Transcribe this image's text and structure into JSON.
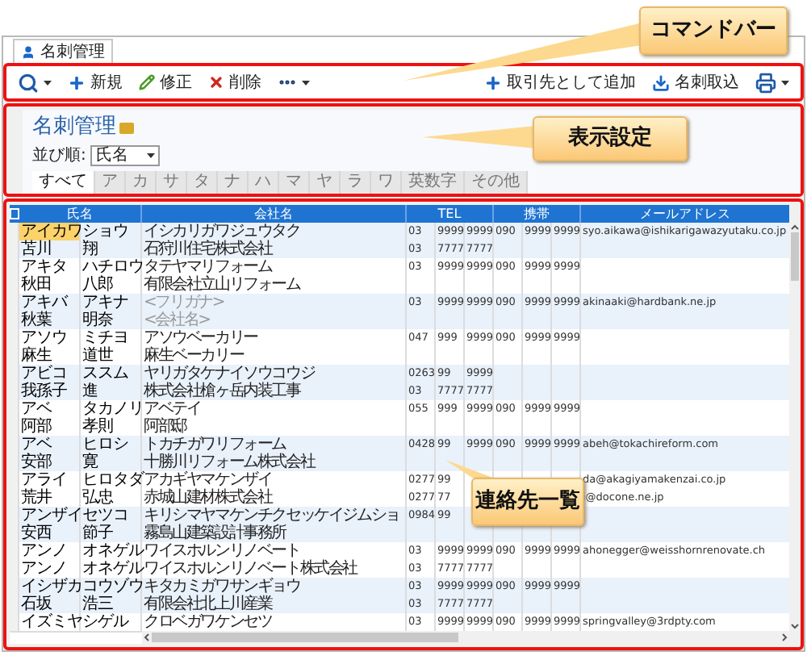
{
  "tab": {
    "label": "名刺管理"
  },
  "toolbar": {
    "left": [
      {
        "kind": "search"
      },
      {
        "kind": "add",
        "label": "新規"
      },
      {
        "kind": "edit",
        "label": "修正"
      },
      {
        "kind": "delete",
        "label": "削除"
      },
      {
        "kind": "more"
      }
    ],
    "right": [
      {
        "kind": "add",
        "label": "取引先として追加"
      },
      {
        "kind": "import",
        "label": "名刺取込"
      },
      {
        "kind": "print"
      }
    ]
  },
  "header": {
    "title": "名刺管理",
    "sort_label": "並び順:",
    "sort_value": "氏名",
    "index_tabs": [
      {
        "label": "すべて",
        "selected": true
      },
      {
        "label": "ア",
        "selected": false
      },
      {
        "label": "カ",
        "selected": false
      },
      {
        "label": "サ",
        "selected": false
      },
      {
        "label": "タ",
        "selected": false
      },
      {
        "label": "ナ",
        "selected": false
      },
      {
        "label": "ハ",
        "selected": false
      },
      {
        "label": "マ",
        "selected": false
      },
      {
        "label": "ヤ",
        "selected": false
      },
      {
        "label": "ラ",
        "selected": false
      },
      {
        "label": "ワ",
        "selected": false
      },
      {
        "label": "英数字",
        "selected": false
      },
      {
        "label": "その他",
        "selected": false
      }
    ]
  },
  "table": {
    "columns": [
      "氏名",
      "会社名",
      "TEL",
      "携帯",
      "メールアドレス"
    ],
    "contacts": [
      {
        "rows": [
          {
            "last": "アイカワ",
            "first": "ショウ",
            "company": "イシカリガワジュウタク",
            "tel": [
              "03",
              "9999",
              "9999"
            ],
            "mobile": [
              "090",
              "9999",
              "9999"
            ],
            "email": "syo.aikawa@ishikarigawazyutaku.co.jp",
            "selected": true,
            "dim": false
          },
          {
            "last": "苫川",
            "first": "翔",
            "company": "石狩川住宅株式会社",
            "tel": [
              "03",
              "7777",
              "7777"
            ],
            "selected": false,
            "dim": false
          }
        ]
      },
      {
        "rows": [
          {
            "last": "アキタ",
            "first": "ハチロウ",
            "company": "タテヤマリフォーム",
            "tel": [
              "03",
              "9999",
              "9999"
            ],
            "mobile": [
              "090",
              "9999",
              "9999"
            ],
            "selected": false,
            "dim": false
          },
          {
            "last": "秋田",
            "first": "八郎",
            "company": "有限会社立山リフォーム",
            "selected": false,
            "dim": false
          }
        ]
      },
      {
        "rows": [
          {
            "last": "アキバ",
            "first": "アキナ",
            "company": "<フリガナ>",
            "tel": [
              "03",
              "9999",
              "9999"
            ],
            "mobile": [
              "090",
              "9999",
              "9999"
            ],
            "email": "akinaaki@hardbank.ne.jp",
            "selected": false,
            "dim": true
          },
          {
            "last": "秋葉",
            "first": "明奈",
            "company": "<会社名>",
            "selected": false,
            "dim": true
          }
        ]
      },
      {
        "rows": [
          {
            "last": "アソウ",
            "first": "ミチヨ",
            "company": "アソウベーカリー",
            "tel": [
              "047",
              "999",
              "9999"
            ],
            "mobile": [
              "090",
              "9999",
              "9999"
            ],
            "selected": false,
            "dim": false
          },
          {
            "last": "麻生",
            "first": "道世",
            "company": "麻生ベーカリー",
            "selected": false,
            "dim": false
          }
        ]
      },
      {
        "rows": [
          {
            "last": "アビコ",
            "first": "ススム",
            "company": "ヤリガタケナイソウコウジ",
            "tel": [
              "0263",
              "99",
              "9999"
            ],
            "selected": false,
            "dim": false
          },
          {
            "last": "我孫子",
            "first": "進",
            "company": "株式会社槍ヶ岳内装工事",
            "tel": [
              "03",
              "7777",
              "7777"
            ],
            "selected": false,
            "dim": false
          }
        ]
      },
      {
        "rows": [
          {
            "last": "アベ",
            "first": "タカノリ",
            "company": "アベテイ",
            "tel": [
              "055",
              "999",
              "9999"
            ],
            "mobile": [
              "090",
              "9999",
              "9999"
            ],
            "selected": false,
            "dim": false
          },
          {
            "last": "阿部",
            "first": "孝則",
            "company": "阿部邸",
            "selected": false,
            "dim": false
          }
        ]
      },
      {
        "rows": [
          {
            "last": "アベ",
            "first": "ヒロシ",
            "company": "トカチガワリフォーム",
            "tel": [
              "0428",
              "99",
              "9999"
            ],
            "mobile": [
              "090",
              "9999",
              "9999"
            ],
            "email": "abeh@tokachireform.com",
            "selected": false,
            "dim": false
          },
          {
            "last": "安部",
            "first": "寛",
            "company": "十勝川リフォーム株式会社",
            "selected": false,
            "dim": false
          }
        ]
      },
      {
        "rows": [
          {
            "last": "アライ",
            "first": "ヒロタダ",
            "company": "アカギヤマケンザイ",
            "tel": [
              "0277",
              "99"
            ],
            "email": "da@akagiyamakenzai.co.jp",
            "selected": false,
            "dim": false
          },
          {
            "last": "荒井",
            "first": "弘忠",
            "company": "赤城山建材株式会社",
            "tel": [
              "0277",
              "77"
            ],
            "email": "i@docone.ne.jp",
            "selected": false,
            "dim": false
          }
        ]
      },
      {
        "rows": [
          {
            "last": "アンザイ",
            "first": "セツコ",
            "company": "キリシマヤマケンチクセッケイジムショ",
            "tel": [
              "0984",
              "99"
            ],
            "selected": false,
            "dim": false
          },
          {
            "last": "安西",
            "first": "節子",
            "company": "霧島山建築設計事務所",
            "selected": false,
            "dim": false
          }
        ]
      },
      {
        "rows": [
          {
            "last": "アンノ",
            "first": "オネゲル",
            "company": "ワイスホルンリノベート",
            "tel": [
              "03",
              "9999",
              "9999"
            ],
            "mobile": [
              "090",
              "9999",
              "9999"
            ],
            "email": "ahonegger@weisshornrenovate.ch",
            "selected": false,
            "dim": false
          },
          {
            "last": "アンノ",
            "first": "オネゲル",
            "company": "ワイスホルンリノベート株式会社",
            "tel": [
              "03",
              "7777",
              "7777"
            ],
            "selected": false,
            "dim": false
          }
        ]
      },
      {
        "rows": [
          {
            "last": "イシザカ",
            "first": "コウゾウ",
            "company": "キタカミガワサンギョウ",
            "tel": [
              "03",
              "9999",
              "9999"
            ],
            "mobile": [
              "090",
              "9999",
              "9999"
            ],
            "selected": false,
            "dim": false
          },
          {
            "last": "石坂",
            "first": "浩三",
            "company": "有限会社北上川産業",
            "tel": [
              "03",
              "7777",
              "7777"
            ],
            "selected": false,
            "dim": false
          }
        ]
      },
      {
        "rows": [
          {
            "last": "イズミヤ",
            "first": "シゲル",
            "company": "クロベガワケンセツ",
            "tel": [
              "03",
              "9999",
              "9999"
            ],
            "mobile": [
              "090",
              "9999",
              "9999"
            ],
            "email": "springvalley@3rdpty.com",
            "selected": false,
            "dim": false
          }
        ]
      }
    ]
  },
  "callouts": [
    {
      "kind": "command",
      "label": "コマンドバー"
    },
    {
      "kind": "display",
      "label": "表示設定"
    },
    {
      "kind": "list",
      "label": "連絡先一覧"
    }
  ]
}
